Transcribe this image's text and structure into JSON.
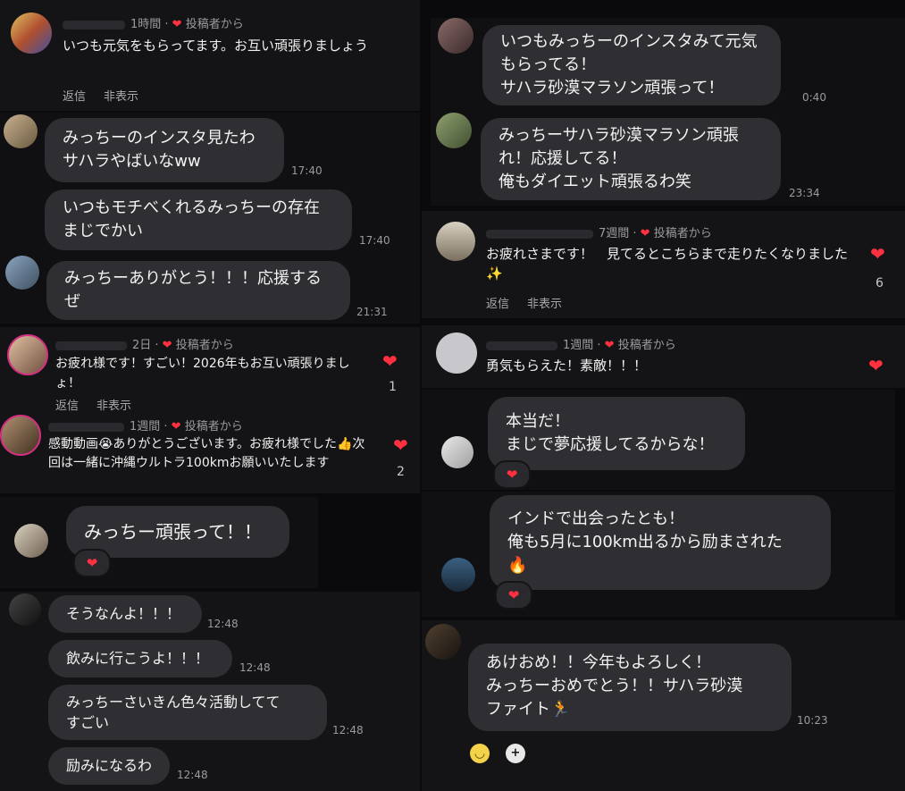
{
  "colors": {
    "heart": "#ff3040",
    "bubble": "#2f2f33",
    "panel": "#141416"
  },
  "left": {
    "c1": {
      "meta": "1時間 · ",
      "from": "投稿者から",
      "text": "いつも元気をもらってます。お互い頑張りましょう",
      "reply": "返信",
      "hide": "非表示"
    },
    "d1": {
      "m1": "みっちーのインスタ見たわ\nサハラやばいなww",
      "t1": "17:40",
      "m2": "いつもモチべくれるみっちーの存在\nまじでかい",
      "t2": "17:40",
      "m3": "みっちーありがとう！！！応援する\nぜ",
      "t3": "21:31"
    },
    "c2": {
      "meta": "2日 · ",
      "from": "投稿者から",
      "text": "お疲れ様です！すごい！2026年もお互い頑張りましょ！",
      "reply": "返信",
      "hide": "非表示",
      "likes": "1"
    },
    "c3": {
      "meta": "1週間 · ",
      "from": "投稿者から",
      "text": "感動動画😭ありがとうございます。お疲れ様でした👍次回は一緒に沖縄ウルトラ100kmお願いいたします",
      "likes": "2"
    },
    "d2": {
      "m1": "みっちー頑張って！！"
    },
    "d3": {
      "m1": "そうなんよ！！！",
      "t1": "12:48",
      "m2": "飲みに行こうよ！！！",
      "t2": "12:48",
      "m3": "みっちーさいきん色々活動してて\nすごい",
      "t3": "12:48",
      "m4": "励みになるわ",
      "t4": "12:48"
    }
  },
  "right": {
    "d1": {
      "m1": "いつもみっちーのインスタみて元気\nもらってる！\nサハラ砂漠マラソン頑張って！",
      "t1": "0:40"
    },
    "d2": {
      "m1": "みっちーサハラ砂漠マラソン頑張\nれ！応援してる！\n俺もダイエット頑張るわ笑",
      "t1": "23:34"
    },
    "c1": {
      "meta": "7週間 · ",
      "from": "投稿者から",
      "text": "お疲れさまです！　見てるとこちらまで走りたくなりました✨",
      "reply": "返信",
      "hide": "非表示",
      "likes": "6"
    },
    "c2": {
      "meta": "1週間 · ",
      "from": "投稿者から",
      "text": "勇気もらえた！素敵！！！"
    },
    "d3": {
      "m1": "本当だ！\nまじで夢応援してるからな！"
    },
    "d4": {
      "m1": "インドで出会ったとも！\n俺も5月に100km出るから励まされた\n🔥"
    },
    "d5": {
      "m1": "あけおめ！！今年もよろしく！\nみっちーおめでとう！！サハラ砂漠\nファイト🏃",
      "t1": "10:23"
    }
  },
  "icons": {
    "heart": "❤",
    "emoji_smile": "🙂"
  }
}
